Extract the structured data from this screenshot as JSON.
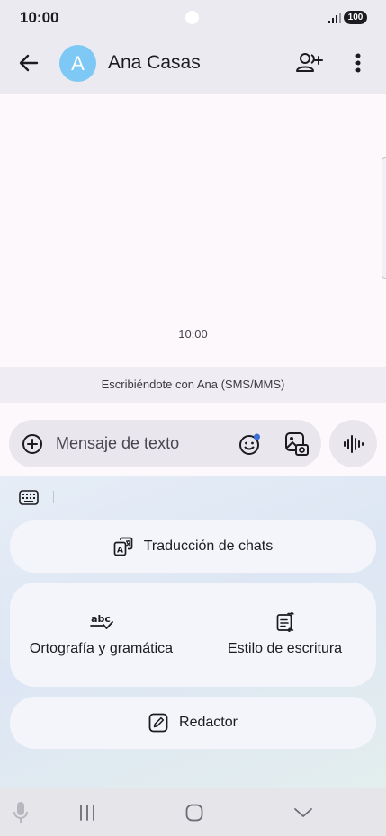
{
  "status_bar": {
    "time": "10:00",
    "battery": "100",
    "icons": [
      "signal-icon",
      "battery-icon"
    ]
  },
  "header": {
    "avatar_letter": "A",
    "contact_name": "Ana Casas",
    "avatar_color": "#7dc8f4",
    "icons": [
      "back-arrow-icon",
      "add-person-icon",
      "more-vert-icon"
    ]
  },
  "conversation": {
    "timestamp": "10:00"
  },
  "sms_notice": "Escribiéndote con Ana (SMS/MMS)",
  "compose": {
    "placeholder": "Mensaje de texto",
    "icons": [
      "add-circle-icon",
      "emoji-icon",
      "gallery-icon",
      "voice-wave-icon"
    ]
  },
  "assistant": {
    "translate_label": "Traducción de chats",
    "spelling_label": "Ortografía y gramática",
    "style_label": "Estilo de escritura",
    "composer_label": "Redactor",
    "icons": [
      "keyboard-icon",
      "translate-icon",
      "spellcheck-icon",
      "writing-style-icon",
      "compose-pen-icon"
    ]
  },
  "nav": {
    "icons": [
      "mic-icon",
      "recents-icon",
      "home-icon",
      "hide-keyboard-icon"
    ]
  },
  "colors": {
    "header_bg": "#ebeaf1",
    "conversation_bg": "#fcf8fc",
    "pill_bg": "#e9e6ee"
  }
}
